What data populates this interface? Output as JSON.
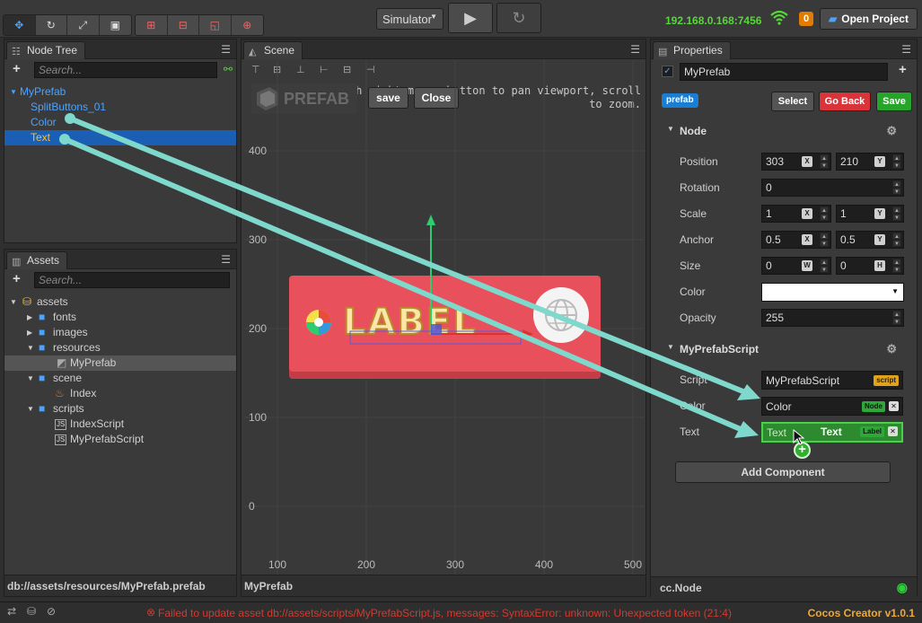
{
  "toolbar": {
    "simulator_label": "Simulator",
    "ip_address": "192.168.0.168:7456",
    "notification_count": "0",
    "open_project_label": "Open Project"
  },
  "node_tree": {
    "tab_label": "Node Tree",
    "search_placeholder": "Search...",
    "items": [
      {
        "label": "MyPrefab"
      },
      {
        "label": "SplitButtons_01"
      },
      {
        "label": "Color"
      },
      {
        "label": "Text"
      }
    ]
  },
  "assets": {
    "tab_label": "Assets",
    "search_placeholder": "Search...",
    "items": [
      {
        "label": "assets"
      },
      {
        "label": "fonts"
      },
      {
        "label": "images"
      },
      {
        "label": "resources"
      },
      {
        "label": "MyPrefab"
      },
      {
        "label": "scene"
      },
      {
        "label": "Index"
      },
      {
        "label": "scripts"
      },
      {
        "label": "IndexScript"
      },
      {
        "label": "MyPrefabScript"
      }
    ],
    "status_path": "db://assets/resources/MyPrefab.prefab"
  },
  "scene": {
    "tab_label": "Scene",
    "hint_line1": "Drag with right mouse button to pan viewport, scroll",
    "hint_line2": "to zoom.",
    "prefab_watermark": "PREFAB",
    "save_label": "save",
    "close_label": "Close",
    "y_ticks": [
      "400",
      "300",
      "200",
      "100",
      "0"
    ],
    "x_ticks": [
      "100",
      "200",
      "300",
      "400",
      "500"
    ],
    "label_text": "LABEL",
    "status_name": "MyPrefab"
  },
  "properties": {
    "tab_label": "Properties",
    "node_name": "MyPrefab",
    "prefab_badge": "prefab",
    "select_label": "Select",
    "go_back_label": "Go Back",
    "save_label": "Save",
    "node_section": "Node",
    "position_label": "Position",
    "position_x": "303",
    "position_y": "210",
    "rotation_label": "Rotation",
    "rotation": "0",
    "scale_label": "Scale",
    "scale_x": "1",
    "scale_y": "1",
    "anchor_label": "Anchor",
    "anchor_x": "0.5",
    "anchor_y": "0.5",
    "size_label": "Size",
    "size_w": "0",
    "size_h": "0",
    "color_label": "Color",
    "opacity_label": "Opacity",
    "opacity": "255",
    "script_section": "MyPrefabScript",
    "script_label": "Script",
    "script_value": "MyPrefabScript",
    "script_tag": "script",
    "color_field_label": "Color",
    "color_field_value": "Color",
    "node_tag": "Node",
    "text_field_label": "Text",
    "text_field_value": "Text",
    "text_drag_value": "Text",
    "label_tag": "Label",
    "add_component_label": "Add Component",
    "status_type": "cc.Node",
    "axis_x": "X",
    "axis_y": "Y",
    "axis_w": "W",
    "axis_h": "H"
  },
  "status": {
    "error_message": "Failed to update asset db://assets/scripts/MyPrefabScript.js, messages: SyntaxError: unknown: Unexpected token (21:4)",
    "version": "Cocos Creator v1.0.1"
  },
  "colors": {
    "accent_blue": "#1a5fb4",
    "ip_green": "#58d63b",
    "error_red": "#d43a2f",
    "version_orange": "#f0a830",
    "prefab_button_red": "#e8505b",
    "drag_arrow": "#7fd8cc"
  }
}
